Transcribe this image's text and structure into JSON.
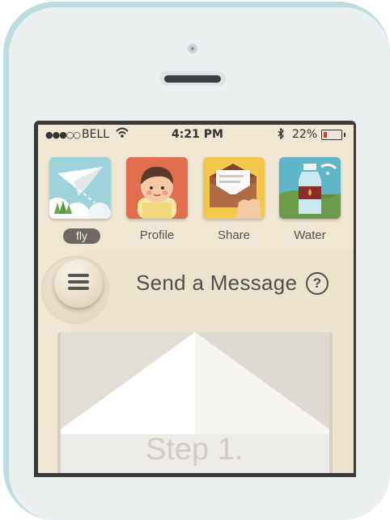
{
  "status_bar": {
    "signal": "●●●○○",
    "carrier": "BELL",
    "time": "4:21 PM",
    "battery": "22%"
  },
  "apps": [
    {
      "label": "fly",
      "icon": "paper-plane-icon",
      "active": true
    },
    {
      "label": "Profile",
      "icon": "person-icon",
      "active": false
    },
    {
      "label": "Share",
      "icon": "envelope-icon",
      "active": false
    },
    {
      "label": "Water",
      "icon": "water-bottle-icon",
      "active": false
    }
  ],
  "header": {
    "title": "Send a Message",
    "help": "?"
  },
  "content": {
    "step": "Step 1."
  },
  "colors": {
    "phone_frame": "#bcdcdf",
    "screen_bg": "#efe6d4",
    "accent_pill": "#6d6862"
  }
}
